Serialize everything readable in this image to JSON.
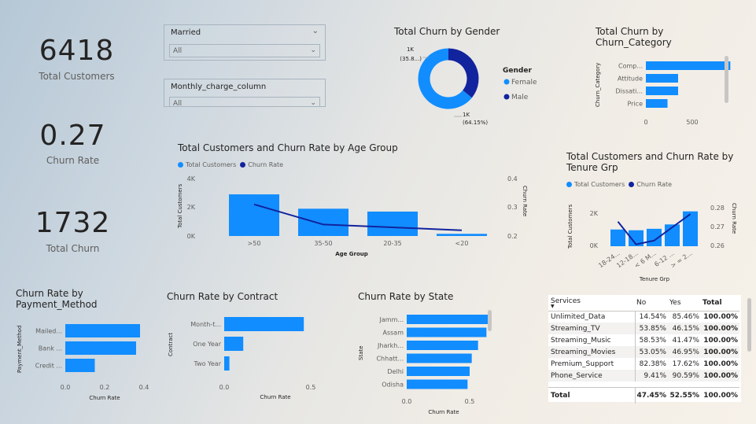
{
  "kpis": {
    "total_customers": {
      "value": "6418",
      "label": "Total Customers"
    },
    "churn_rate": {
      "value": "0.27",
      "label": "Churn Rate"
    },
    "total_churn": {
      "value": "1732",
      "label": "Total Churn"
    }
  },
  "slicers": {
    "married": {
      "title": "Married",
      "selected": "All"
    },
    "monthly_charge": {
      "title": "Monthly_charge_column",
      "selected": "All"
    }
  },
  "gender_chart": {
    "title": "Total Churn by Gender",
    "legend_title": "Gender",
    "label_female": "1K",
    "label_female_pct": "(64.15%)",
    "label_male": "1K",
    "label_male_pct": "(35.8...)",
    "female_color": "#118dff",
    "male_color": "#12239e"
  },
  "churn_category_chart": {
    "title_line1": "Total Churn by",
    "title_line2": "Churn_Category",
    "ylabel": "Churn_Category",
    "tick_0": "0",
    "tick_500": "500"
  },
  "age_chart": {
    "title": "Total Customers and Churn Rate by Age Group",
    "legend_total": "Total Customers",
    "legend_rate": "Churn Rate",
    "ylabel_left": "Total Customers",
    "ylabel_right": "Churn Rate",
    "xlabel": "Age Group",
    "left_ticks": [
      "4K",
      "2K",
      "0K"
    ],
    "right_ticks": [
      "0.4",
      "0.3",
      "0.2"
    ]
  },
  "tenure_chart": {
    "title_line1": "Total Customers and Churn Rate by",
    "title_line2": "Tenure Grp",
    "legend_total": "Total Customers",
    "legend_rate": "Churn Rate",
    "ylabel_left": "Total Customers",
    "ylabel_right": "Churn Rate",
    "xlabel": "Tenure Grp",
    "left_ticks": [
      "2K",
      "0K"
    ],
    "right_ticks": [
      "0.28",
      "0.27",
      "0.26"
    ]
  },
  "payment_chart": {
    "title_line1": "Churn Rate by",
    "title_line2": "Payment_Method",
    "ylabel": "Payment_Method",
    "xlabel": "Churn Rate",
    "ticks": [
      "0.0",
      "0.2",
      "0.4"
    ]
  },
  "contract_chart": {
    "title": "Churn Rate by Contract",
    "ylabel": "Contract",
    "xlabel": "Churn Rate",
    "ticks": [
      "0.0",
      "0.5"
    ]
  },
  "state_chart": {
    "title": "Churn Rate by State",
    "ylabel": "State",
    "xlabel": "Churn Rate",
    "ticks": [
      "0.0",
      "0.5"
    ]
  },
  "services_table": {
    "headers": [
      "Services",
      "No",
      "Yes",
      "Total"
    ],
    "rows": [
      [
        "Unlimited_Data",
        "14.54%",
        "85.46%",
        "100.00%"
      ],
      [
        "Streaming_TV",
        "53.85%",
        "46.15%",
        "100.00%"
      ],
      [
        "Streaming_Music",
        "58.53%",
        "41.47%",
        "100.00%"
      ],
      [
        "Streaming_Movies",
        "53.05%",
        "46.95%",
        "100.00%"
      ],
      [
        "Premium_Support",
        "82.38%",
        "17.62%",
        "100.00%"
      ],
      [
        "Phone_Service",
        "9.41%",
        "90.59%",
        "100.00%"
      ]
    ],
    "total_row": [
      "Total",
      "47.45%",
      "52.55%",
      "100.00%"
    ]
  },
  "chart_data": [
    {
      "type": "pie",
      "title": "Total Churn by Gender",
      "categories": [
        "Female",
        "Male"
      ],
      "values": [
        64.15,
        35.85
      ],
      "legend": "right"
    },
    {
      "type": "bar",
      "title": "Total Churn by Churn_Category",
      "orientation": "horizontal",
      "categories": [
        "Comp...",
        "Attitude",
        "Dissati...",
        "Price"
      ],
      "values": [
        760,
        290,
        290,
        195
      ],
      "ylabel": "Churn_Category",
      "xlim": [
        0,
        800
      ]
    },
    {
      "type": "bar",
      "title": "Total Customers and Churn Rate by Age Group",
      "categories": [
        ">50",
        "35-50",
        "20-35",
        "<20"
      ],
      "series": [
        {
          "name": "Total Customers",
          "type": "bar",
          "values": [
            2900,
            1900,
            1700,
            150
          ]
        },
        {
          "name": "Churn Rate",
          "type": "line",
          "values": [
            0.31,
            0.24,
            0.23,
            0.22
          ]
        }
      ],
      "xlabel": "Age Group",
      "ylabel": "Total Customers",
      "ylim": [
        0,
        4000
      ],
      "y2lim": [
        0.2,
        0.4
      ],
      "legend": "top-left"
    },
    {
      "type": "bar",
      "title": "Total Customers and Churn Rate by Tenure Grp",
      "categories": [
        "18-24...",
        "12-18...",
        "< 6 M...",
        "6-12 ...",
        "> = 2..."
      ],
      "series": [
        {
          "name": "Total Customers",
          "type": "bar",
          "values": [
            1150,
            1100,
            1200,
            1500,
            2400
          ]
        },
        {
          "name": "Churn Rate",
          "type": "line",
          "values": [
            0.273,
            0.261,
            0.263,
            0.27,
            0.277
          ]
        }
      ],
      "xlabel": "Tenure Grp",
      "ylabel": "Total Customers",
      "ylim": [
        0,
        2600
      ],
      "y2lim": [
        0.26,
        0.28
      ],
      "legend": "top-left"
    },
    {
      "type": "bar",
      "title": "Churn Rate by Payment_Method",
      "orientation": "horizontal",
      "categories": [
        "Mailed...",
        "Bank ...",
        "Credit ..."
      ],
      "values": [
        0.38,
        0.36,
        0.15
      ],
      "xlabel": "Churn Rate",
      "ylabel": "Payment_Method",
      "xlim": [
        0,
        0.4
      ]
    },
    {
      "type": "bar",
      "title": "Churn Rate by Contract",
      "orientation": "horizontal",
      "categories": [
        "Month-t...",
        "One Year",
        "Two Year"
      ],
      "values": [
        0.46,
        0.11,
        0.03
      ],
      "xlabel": "Churn Rate",
      "ylabel": "Contract",
      "xlim": [
        0,
        0.5
      ]
    },
    {
      "type": "bar",
      "title": "Churn Rate by State",
      "orientation": "horizontal",
      "categories": [
        "Jamm...",
        "Assam",
        "Jharkh...",
        "Chhatt...",
        "Delhi",
        "Odisha"
      ],
      "values": [
        0.57,
        0.38,
        0.34,
        0.31,
        0.3,
        0.29
      ],
      "xlabel": "Churn Rate",
      "ylabel": "State",
      "xlim": [
        0,
        0.6
      ]
    }
  ]
}
